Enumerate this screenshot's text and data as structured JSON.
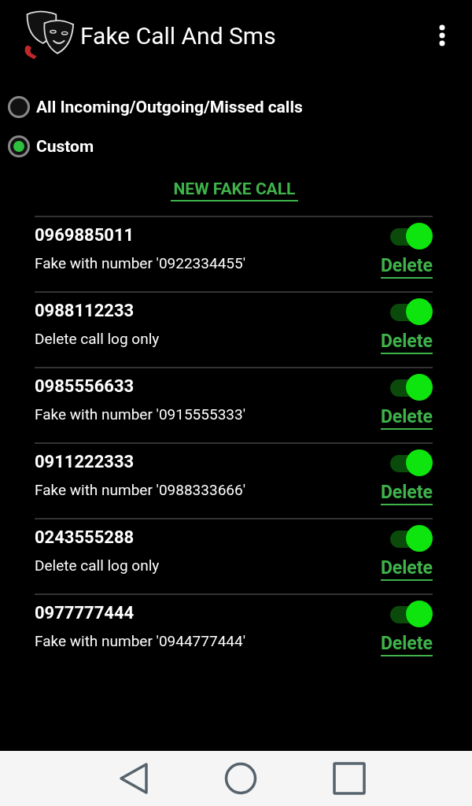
{
  "app_bar": {
    "title": "Fake Call And Sms"
  },
  "mode_options": [
    {
      "label": "All Incoming/Outgoing/Missed calls",
      "selected": false
    },
    {
      "label": "Custom",
      "selected": true
    }
  ],
  "new_button": "NEW FAKE CALL",
  "calls": [
    {
      "number": "0969885011",
      "detail": "Fake with number '0922334455'",
      "on": true,
      "action": "Delete"
    },
    {
      "number": "0988112233",
      "detail": "Delete call log only",
      "on": true,
      "action": "Delete"
    },
    {
      "number": "0985556633",
      "detail": "Fake with number '0915555333'",
      "on": true,
      "action": "Delete"
    },
    {
      "number": "0911222333",
      "detail": "Fake with number '0988333666'",
      "on": true,
      "action": "Delete"
    },
    {
      "number": "0243555288",
      "detail": "Delete call log only",
      "on": true,
      "action": "Delete"
    },
    {
      "number": "0977777444",
      "detail": "Fake with number '0944777444'",
      "on": true,
      "action": "Delete"
    }
  ]
}
